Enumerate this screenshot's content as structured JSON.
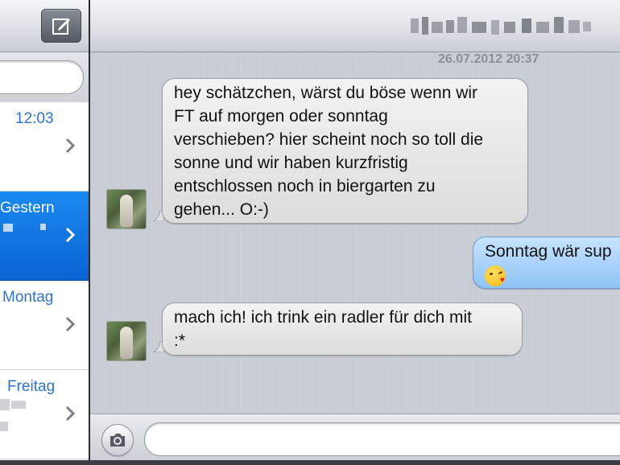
{
  "colors": {
    "accent": "#2f73d3",
    "selected_row": "#0a63d2",
    "incoming_bubble": "#e6e6e6",
    "outgoing_bubble": "#a9d1f8"
  },
  "sidebar": {
    "compose_icon": "compose-icon",
    "conversations": [
      {
        "time": "12:03",
        "selected": false
      },
      {
        "time": "Gestern",
        "selected": true
      },
      {
        "time": "Montag",
        "selected": false
      },
      {
        "time": "Freitag",
        "selected": false
      }
    ]
  },
  "chat": {
    "contact_name_obscured": true,
    "timestamp": "26.07.2012 20:37",
    "messages": [
      {
        "direction": "incoming",
        "text": "hey schätzchen, wärst du böse wenn wir\nFT auf morgen oder sonntag\nverschieben? hier scheint noch so toll die\nsonne und wir haben kurzfristig\nentschlossen noch in biergarten zu\ngehen...  O:-)"
      },
      {
        "direction": "outgoing",
        "text": "Sonntag wär  sup",
        "emoji": "kissing-face-with-heart"
      },
      {
        "direction": "incoming",
        "text": "mach ich! ich trink ein radler für dich mit\n:*"
      }
    ]
  },
  "input": {
    "camera_icon": "camera-icon",
    "message_placeholder": ""
  }
}
